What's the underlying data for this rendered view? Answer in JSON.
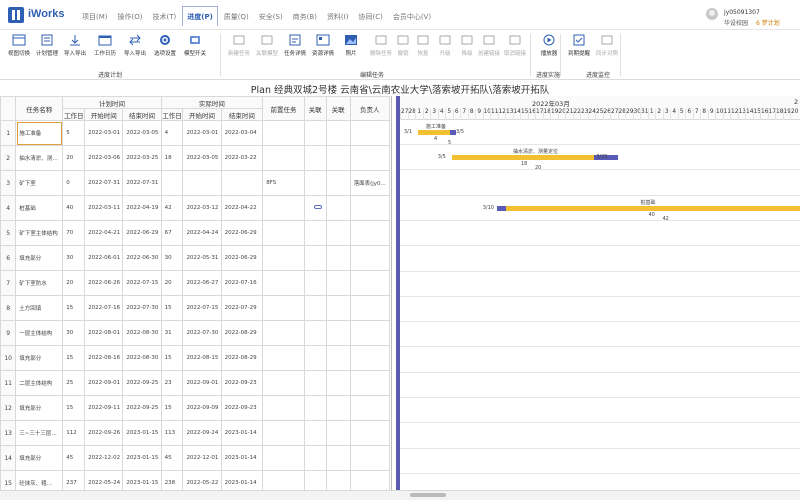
{
  "app": {
    "name": "iWorks"
  },
  "nav": [
    "项目(M)",
    "操作(O)",
    "技术(T)",
    "进度(P)",
    "质量(Q)",
    "安全(S)",
    "商务(B)",
    "资料(I)",
    "协同(C)",
    "会员中心(V)"
  ],
  "user": {
    "id": "jy05091307",
    "org": "华设校园",
    "badge": "6 梦计划"
  },
  "ribbon": {
    "tools": [
      {
        "label": "视图切换",
        "icon": "view-switch-icon",
        "enabled": true
      },
      {
        "label": "计划管理",
        "icon": "plan-manage-icon",
        "enabled": true
      },
      {
        "label": "导入导出",
        "icon": "import-export-icon",
        "enabled": true
      },
      {
        "label": "工作日历",
        "icon": "calendar-icon",
        "enabled": true
      },
      {
        "label": "导入导出",
        "icon": "exchange-icon",
        "enabled": true
      },
      {
        "label": "选项设置",
        "icon": "gear-icon",
        "enabled": true
      },
      {
        "label": "模型开关",
        "icon": "model-icon",
        "enabled": true
      },
      {
        "label": "新建任务",
        "icon": "new-task-icon",
        "enabled": false
      },
      {
        "label": "关联模型",
        "icon": "link-model-icon",
        "enabled": false
      },
      {
        "label": "任务详情",
        "icon": "task-detail-icon",
        "enabled": true
      },
      {
        "label": "资源详情",
        "icon": "resource-icon",
        "enabled": true
      },
      {
        "label": "照片",
        "icon": "photo-icon",
        "enabled": true
      },
      {
        "label": "删除任务",
        "icon": "delete-icon",
        "enabled": false
      },
      {
        "label": "撤销",
        "icon": "undo-icon",
        "enabled": false
      },
      {
        "label": "恢复",
        "icon": "redo-icon",
        "enabled": false
      },
      {
        "label": "升级",
        "icon": "upgrade-icon",
        "enabled": false
      },
      {
        "label": "降级",
        "icon": "downgrade-icon",
        "enabled": false
      },
      {
        "label": "创建链接",
        "icon": "create-link-icon",
        "enabled": false
      },
      {
        "label": "取消链接",
        "icon": "cancel-link-icon",
        "enabled": false
      },
      {
        "label": "播放器",
        "icon": "play-icon",
        "enabled": true
      },
      {
        "label": "到期提醒",
        "icon": "reminder-icon",
        "enabled": true
      },
      {
        "label": "同步对照",
        "icon": "sync-icon",
        "enabled": false
      }
    ],
    "groups": [
      "进度计划",
      "编辑任务",
      "进度实施",
      "进度监控"
    ]
  },
  "title": "Plan 经典双城2号楼 云南省\\云南农业大学\\落索坡开拓队\\落索坡开拓队",
  "table": {
    "group_headers": {
      "plan": "计划时间",
      "actual": "实际时间"
    },
    "columns": [
      "任务名称",
      "工作日",
      "开始时间",
      "结束时间",
      "工作日",
      "开始时间",
      "结束时间",
      "前置任务",
      "关联",
      "关联",
      "负责人"
    ],
    "rows": [
      {
        "n": "1",
        "name": "施工准备",
        "pd": "5",
        "ps": "2022-03-01",
        "pe": "2022-03-05",
        "ad": "4",
        "as": "2022-03-01",
        "ae": "2022-03-04",
        "pre": "",
        "owner": ""
      },
      {
        "n": "2",
        "name": "抽水清淤、测量定位",
        "pd": "20",
        "ps": "2022-03-06",
        "pe": "2022-03-25",
        "ad": "18",
        "as": "2022-03-05",
        "ae": "2022-03-22",
        "pre": "",
        "owner": ""
      },
      {
        "n": "3",
        "name": "矿下室",
        "pd": "0",
        "ps": "2022-07-31",
        "pe": "2022-07-31",
        "ad": "",
        "as": "",
        "ae": "",
        "pre": "8FS",
        "owner": "落面表(jy0..."
      },
      {
        "n": "4",
        "name": "桩基础",
        "pd": "40",
        "ps": "2022-03-11",
        "pe": "2022-04-19",
        "ad": "42",
        "as": "2022-03-12",
        "ae": "2022-04-22",
        "pre": "",
        "owner": ""
      },
      {
        "n": "5",
        "name": "矿下室主体结构",
        "pd": "70",
        "ps": "2022-04-21",
        "pe": "2022-06-29",
        "ad": "67",
        "as": "2022-04-24",
        "ae": "2022-06-29",
        "pre": "",
        "owner": ""
      },
      {
        "n": "6",
        "name": "填充部分",
        "pd": "30",
        "ps": "2022-06-01",
        "pe": "2022-06-30",
        "ad": "30",
        "as": "2022-05-31",
        "ae": "2022-06-29",
        "pre": "",
        "owner": ""
      },
      {
        "n": "7",
        "name": "矿下室防水",
        "pd": "20",
        "ps": "2022-06-26",
        "pe": "2022-07-15",
        "ad": "20",
        "as": "2022-06-27",
        "ae": "2022-07-16",
        "pre": "",
        "owner": ""
      },
      {
        "n": "8",
        "name": "土方回填",
        "pd": "15",
        "ps": "2022-07-16",
        "pe": "2022-07-30",
        "ad": "15",
        "as": "2022-07-15",
        "ae": "2022-07-29",
        "pre": "",
        "owner": ""
      },
      {
        "n": "9",
        "name": "一层主体结构",
        "pd": "30",
        "ps": "2022-08-01",
        "pe": "2022-08-30",
        "ad": "31",
        "as": "2022-07-30",
        "ae": "2022-08-29",
        "pre": "",
        "owner": ""
      },
      {
        "n": "10",
        "name": "填充部分",
        "pd": "15",
        "ps": "2022-08-16",
        "pe": "2022-08-30",
        "ad": "15",
        "as": "2022-08-15",
        "ae": "2022-08-29",
        "pre": "",
        "owner": ""
      },
      {
        "n": "11",
        "name": "二层主体结构",
        "pd": "25",
        "ps": "2022-09-01",
        "pe": "2022-09-25",
        "ad": "23",
        "as": "2022-09-01",
        "ae": "2022-09-23",
        "pre": "",
        "owner": ""
      },
      {
        "n": "12",
        "name": "填充部分",
        "pd": "15",
        "ps": "2022-09-11",
        "pe": "2022-09-25",
        "ad": "15",
        "as": "2022-09-09",
        "ae": "2022-09-23",
        "pre": "",
        "owner": ""
      },
      {
        "n": "13",
        "name": "三~三十三层主体",
        "pd": "112",
        "ps": "2022-09-26",
        "pe": "2023-01-15",
        "ad": "113",
        "as": "2022-09-24",
        "ae": "2023-01-14",
        "pre": "",
        "owner": ""
      },
      {
        "n": "14",
        "name": "填充部分",
        "pd": "45",
        "ps": "2022-12-02",
        "pe": "2023-01-15",
        "ad": "45",
        "as": "2022-12-01",
        "ae": "2023-01-14",
        "pre": "",
        "owner": ""
      },
      {
        "n": "15",
        "name": "砼抹灰、粗...",
        "pd": "237",
        "ps": "2022-05-24",
        "pe": "2023-01-15",
        "ad": "238",
        "as": "2022-05-22",
        "ae": "2023-01-14",
        "pre": "",
        "owner": ""
      }
    ]
  },
  "gantt": {
    "month": "2022年03月",
    "month_next": "2",
    "days": [
      "27",
      "28",
      "1",
      "2",
      "3",
      "4",
      "5",
      "6",
      "7",
      "8",
      "9",
      "10",
      "11",
      "12",
      "13",
      "14",
      "15",
      "16",
      "17",
      "18",
      "19",
      "20",
      "21",
      "22",
      "23",
      "24",
      "25",
      "26",
      "27",
      "28",
      "29",
      "30",
      "31",
      "1",
      "2",
      "3",
      "4",
      "5",
      "6",
      "7",
      "8",
      "9",
      "10",
      "11",
      "12",
      "13",
      "14",
      "15",
      "16",
      "17",
      "18",
      "19",
      "20"
    ],
    "bars": [
      {
        "row": 0,
        "title": "施工准备",
        "start_label": "3/1",
        "end_label": "3/5",
        "mid_label": "4",
        "mid_label2": "5",
        "start": 2,
        "plan_len": 4.8,
        "prog_start": 4.2,
        "prog_len": 0.9
      },
      {
        "row": 1,
        "title": "抽水清淤、测量定位",
        "start_label": "3/5",
        "end_label": "3/25",
        "mid_label": "18",
        "mid_label2": "20",
        "start": 6.5,
        "plan_len": 19,
        "prog_start": 19,
        "prog_len": 3.2
      },
      {
        "row": 3,
        "title": "桩基础",
        "start_label": "3/10",
        "end_label": "",
        "mid_label": "40",
        "mid_label2": "42",
        "start": 12.5,
        "plan_len": 41,
        "prog_start": 0,
        "prog_len": 1.2
      }
    ]
  }
}
